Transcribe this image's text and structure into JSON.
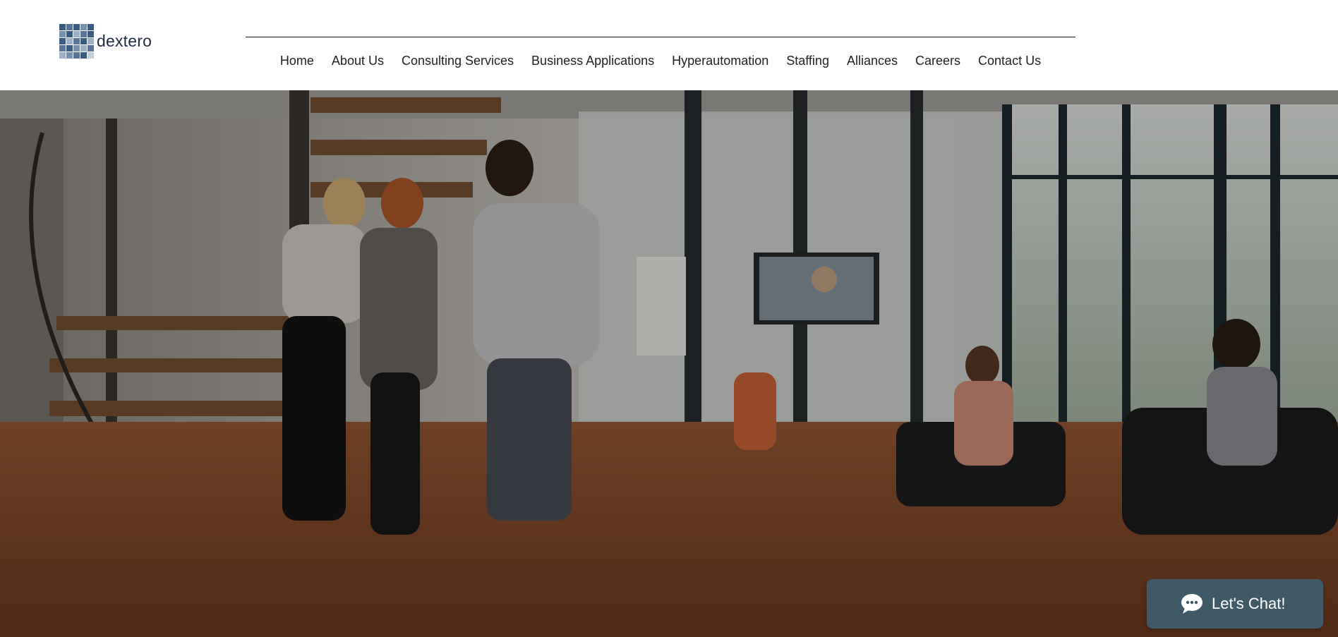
{
  "brand": {
    "name": "dextero",
    "grid_colors": [
      "#3d5a80",
      "#5a7396",
      "#3d5a80",
      "#7b8fab",
      "#3d5a80",
      "#7b8fab",
      "#3d5a80",
      "#9fb0c6",
      "#5a7396",
      "#3d5a80",
      "#3d5a80",
      "#9fb0c6",
      "#5a7396",
      "#3d5a80",
      "#9fb0c6",
      "#5a7396",
      "#3d5a80",
      "#7b8fab",
      "#9fb0c6",
      "#5a7396",
      "#9fb0c6",
      "#7b8fab",
      "#5a7396",
      "#3d5a80",
      "#c4cfdc"
    ]
  },
  "nav": {
    "items": [
      {
        "label": "Home"
      },
      {
        "label": "About Us"
      },
      {
        "label": "Consulting Services"
      },
      {
        "label": "Business Applications"
      },
      {
        "label": "Hyperautomation"
      },
      {
        "label": "Staffing"
      },
      {
        "label": "Alliances"
      },
      {
        "label": "Careers"
      },
      {
        "label": "Contact Us"
      }
    ]
  },
  "hero": {
    "image": "office-team-photo",
    "colors": {
      "floor": "#8a4b2a",
      "wall": "#c9c6c0",
      "overlay": "rgba(0,0,0,0.28)"
    }
  },
  "chat": {
    "label": "Let's Chat!",
    "icon": "chat-bubble-icon",
    "color": "#3f5a66"
  }
}
